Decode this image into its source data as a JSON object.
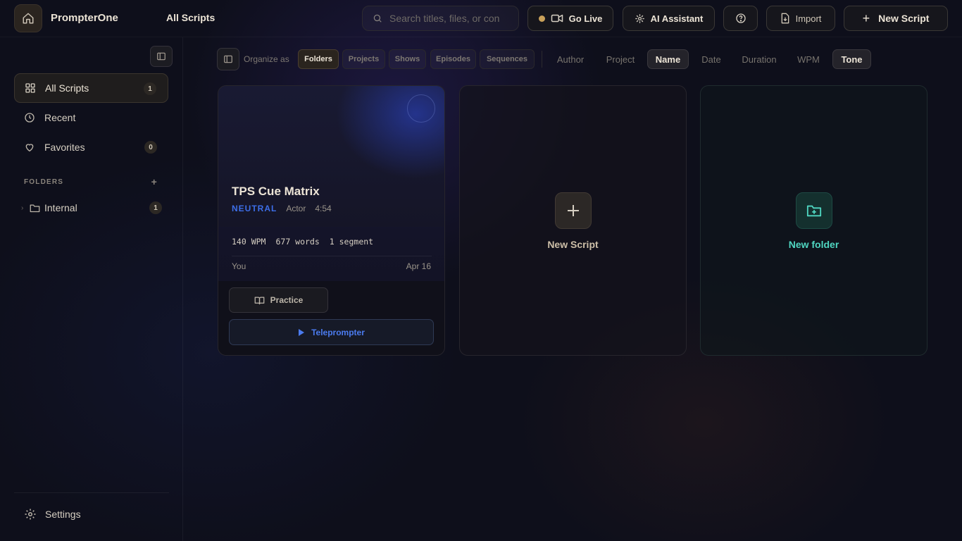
{
  "app": {
    "name": "PrompterOne",
    "breadcrumb": "All Scripts"
  },
  "header": {
    "search_placeholder": "Search titles, files, or con",
    "go_live_label": "Go Live",
    "ai_assistant_label": "AI Assistant",
    "import_label": "Import",
    "new_script_label": "New Script"
  },
  "sidebar": {
    "items": [
      {
        "label": "All Scripts",
        "count": "1",
        "icon": "grid-icon",
        "active": true
      },
      {
        "label": "Recent",
        "icon": "clock-icon"
      },
      {
        "label": "Favorites",
        "count": "0",
        "icon": "heart-icon"
      }
    ],
    "folders_heading": "FOLDERS",
    "folders": [
      {
        "label": "Internal",
        "count": "1"
      }
    ],
    "settings_label": "Settings"
  },
  "toolbar": {
    "organize_label": "Organize as",
    "organize_options": [
      "Folders",
      "Projects",
      "Shows",
      "Episodes",
      "Sequences"
    ],
    "organize_selected": "Folders",
    "sort_options": [
      "Author",
      "Project",
      "Name",
      "Date",
      "Duration",
      "WPM",
      "Tone"
    ],
    "sort_selected": [
      "Name",
      "Tone"
    ]
  },
  "script_card": {
    "title": "TPS Cue Matrix",
    "tone": "NEUTRAL",
    "role": "Actor",
    "duration": "4:54",
    "wpm": "140 WPM",
    "words": "677 words",
    "segments": "1 segment",
    "owner": "You",
    "date": "Apr 16",
    "practice_label": "Practice",
    "teleprompter_label": "Teleprompter"
  },
  "new_script_card": {
    "label": "New Script"
  },
  "new_folder_card": {
    "label": "New folder"
  },
  "colors": {
    "accent_gold": "#c9a15a",
    "tone_blue": "#3d6ee8",
    "teal": "#4fd6c1",
    "background": "#0e0f1b"
  }
}
